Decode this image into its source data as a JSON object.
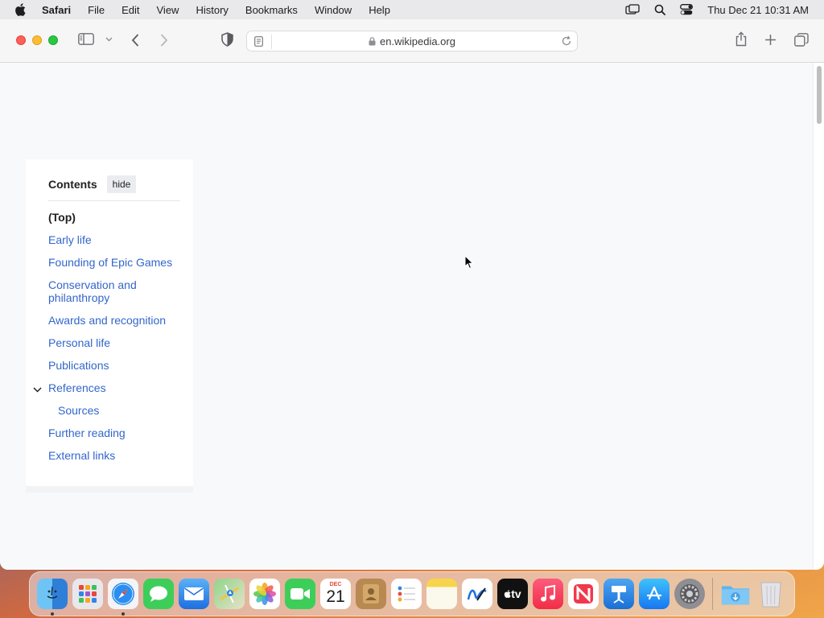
{
  "menubar": {
    "app_name": "Safari",
    "items": [
      "File",
      "Edit",
      "View",
      "History",
      "Bookmarks",
      "Window",
      "Help"
    ],
    "clock": "Thu Dec 21  10:31 AM"
  },
  "browser": {
    "url": "en.wikipedia.org"
  },
  "toc": {
    "title": "Contents",
    "hide_label": "hide",
    "items": [
      {
        "label": "(Top)"
      },
      {
        "label": "Early life"
      },
      {
        "label": "Founding of Epic Games"
      },
      {
        "label": "Conservation and philanthropy"
      },
      {
        "label": "Awards and recognition"
      },
      {
        "label": "Personal life"
      },
      {
        "label": "Publications"
      },
      {
        "label": "References"
      },
      {
        "label": "Sources"
      },
      {
        "label": "Further reading"
      },
      {
        "label": "External links"
      }
    ]
  },
  "dock": {
    "calendar_month": "DEC",
    "calendar_day": "21",
    "tv_label": "tv",
    "apps": [
      "finder",
      "launchpad",
      "safari",
      "messages",
      "mail",
      "maps",
      "photos",
      "facetime",
      "calendar",
      "contacts",
      "reminders",
      "notes",
      "freeform",
      "tv",
      "music",
      "news",
      "keynote",
      "app-store",
      "system-settings",
      "downloads",
      "trash"
    ]
  },
  "colors": {
    "link": "#3366cc",
    "menubar_bg": "#e9e9ec",
    "page_bg": "#f8f9fa"
  }
}
